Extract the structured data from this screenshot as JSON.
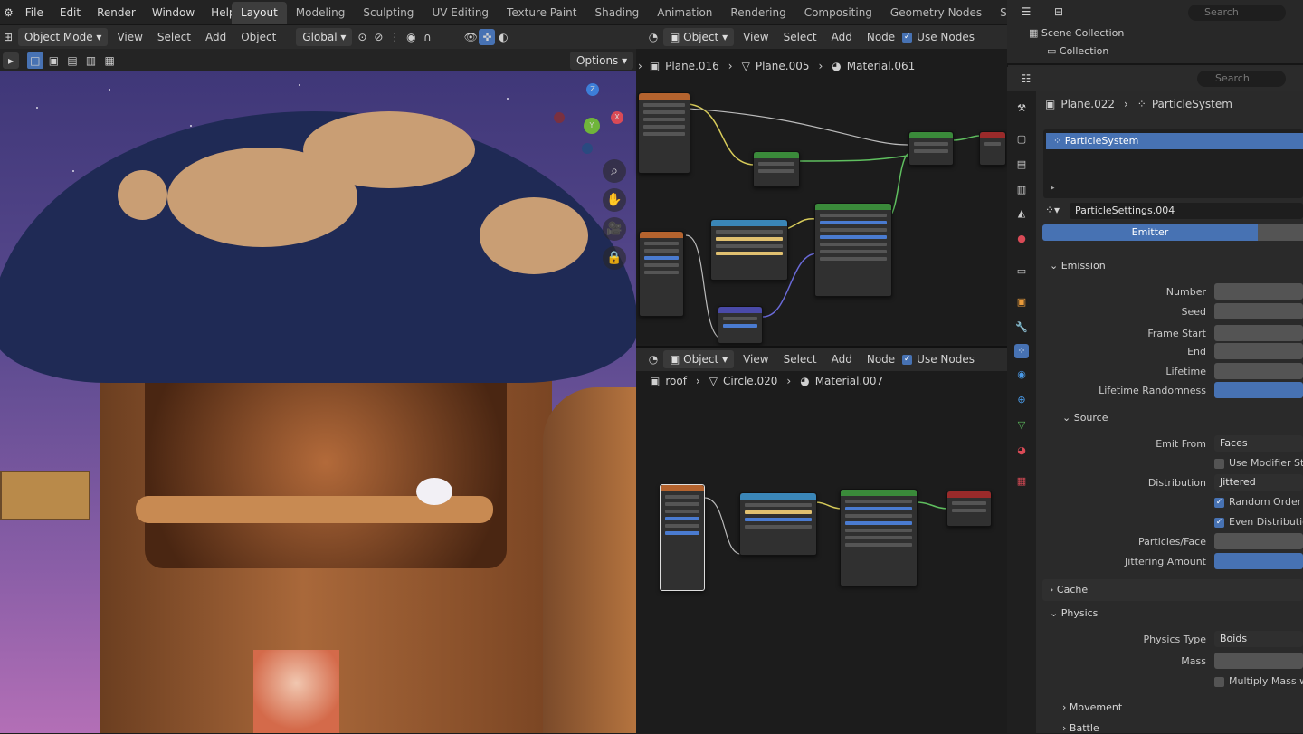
{
  "menu": [
    "File",
    "Edit",
    "Render",
    "Window",
    "Help"
  ],
  "workspaces": [
    "Layout",
    "Modeling",
    "Sculpting",
    "UV Editing",
    "Texture Paint",
    "Shading",
    "Animation",
    "Rendering",
    "Compositing",
    "Geometry Nodes",
    "Scripting"
  ],
  "active_workspace": "Layout",
  "viewport_header": {
    "mode": "Object Mode",
    "items": [
      "View",
      "Select",
      "Add",
      "Object"
    ],
    "transform": "Global",
    "options": "Options"
  },
  "node_editor_top": {
    "type": "Object",
    "items": [
      "View",
      "Select",
      "Add",
      "Node"
    ],
    "use_nodes": "Use Nodes",
    "breadcrumb": [
      "Plane.016",
      "Plane.005",
      "Material.061"
    ]
  },
  "node_editor_bottom": {
    "type": "Object",
    "items": [
      "View",
      "Select",
      "Add",
      "Node"
    ],
    "use_nodes": "Use Nodes",
    "breadcrumb": [
      "roof",
      "Circle.020",
      "Material.007"
    ]
  },
  "outliner": {
    "search": "Search",
    "items": [
      "Scene Collection",
      "Collection"
    ]
  },
  "properties": {
    "search": "Search",
    "breadcrumb": [
      "Plane.022",
      "ParticleSystem"
    ],
    "particle_system": "ParticleSystem",
    "settings": "ParticleSettings.004",
    "type": "Emitter",
    "sections": {
      "emission": "Emission",
      "source": "Source",
      "cache": "Cache",
      "physics": "Physics",
      "movement": "Movement",
      "battle": "Battle"
    },
    "emission_fields": [
      "Number",
      "Seed",
      "Frame Start",
      "End",
      "Lifetime",
      "Lifetime Randomness"
    ],
    "emit_from_label": "Emit From",
    "emit_from": "Faces",
    "use_modifier_stack": "Use Modifier St",
    "distribution_label": "Distribution",
    "distribution": "Jittered",
    "random_order": "Random Order",
    "even_distribution": "Even Distributio",
    "particles_face": "Particles/Face",
    "jittering_amount": "Jittering Amount",
    "physics_type_label": "Physics Type",
    "physics_type": "Boids",
    "mass": "Mass",
    "multiply_mass": "Multiply Mass w"
  }
}
